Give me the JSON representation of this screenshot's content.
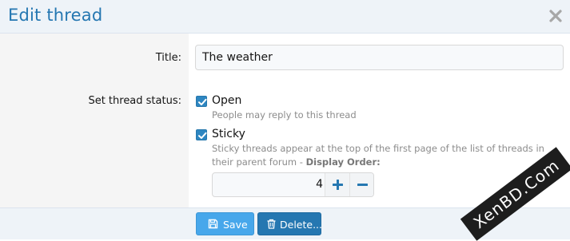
{
  "dialog": {
    "title": "Edit thread",
    "close_icon": "close-icon"
  },
  "form": {
    "title_label": "Title:",
    "title_value": "The weather",
    "status_label": "Set thread status:",
    "open": {
      "label": "Open",
      "checked": true,
      "hint": "People may reply to this thread"
    },
    "sticky": {
      "label": "Sticky",
      "checked": true,
      "hint": "Sticky threads appear at the top of the first page of the list of threads in their parent forum - ",
      "hint_bold": "Display Order:"
    },
    "display_order": {
      "value": "4",
      "increment_icon": "plus-icon",
      "decrement_icon": "minus-icon"
    }
  },
  "footer": {
    "save_label": "Save",
    "save_icon": "save-icon",
    "delete_label": "Delete...",
    "delete_icon": "trash-icon"
  },
  "watermark": {
    "text": "XenBD.Com"
  },
  "colors": {
    "accent": "#2577b1",
    "save_button": "#47a7eb",
    "delete_button": "#2577b1",
    "checkbox": "#2e86c1",
    "header_bg": "#eef3f8",
    "label_col_bg": "#f5f5f5"
  }
}
